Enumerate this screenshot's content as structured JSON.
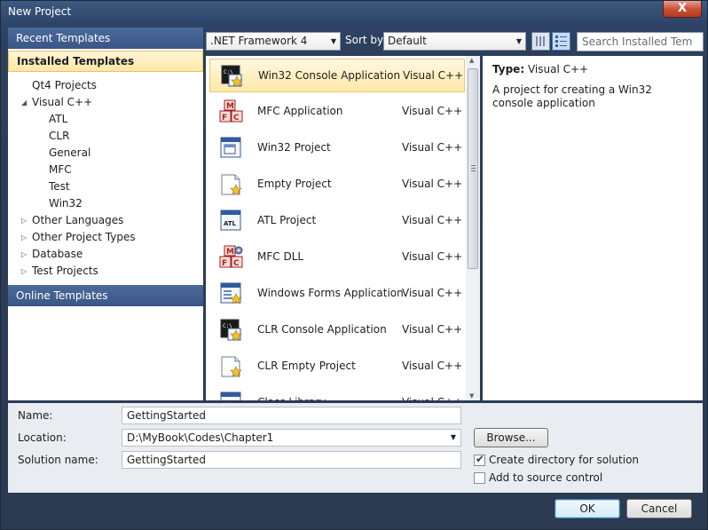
{
  "window": {
    "title": "New Project",
    "close_glyph": "X"
  },
  "left": {
    "recent": "Recent Templates",
    "installed": "Installed Templates",
    "online": "Online Templates",
    "tree": [
      {
        "label": "Qt4 Projects",
        "level": 0,
        "arrow": ""
      },
      {
        "label": "Visual C++",
        "level": 0,
        "arrow": "◢"
      },
      {
        "label": "ATL",
        "level": 1,
        "arrow": ""
      },
      {
        "label": "CLR",
        "level": 1,
        "arrow": ""
      },
      {
        "label": "General",
        "level": 1,
        "arrow": ""
      },
      {
        "label": "MFC",
        "level": 1,
        "arrow": ""
      },
      {
        "label": "Test",
        "level": 1,
        "arrow": ""
      },
      {
        "label": "Win32",
        "level": 1,
        "arrow": ""
      },
      {
        "label": "Other Languages",
        "level": 0,
        "arrow": "▷"
      },
      {
        "label": "Other Project Types",
        "level": 0,
        "arrow": "▷"
      },
      {
        "label": "Database",
        "level": 0,
        "arrow": "▷"
      },
      {
        "label": "Test Projects",
        "level": 0,
        "arrow": "▷"
      }
    ]
  },
  "toolbar": {
    "framework": ".NET Framework 4",
    "sort_label": "Sort by:",
    "sort_value": "Default",
    "search_placeholder": "Search Installed Tem"
  },
  "templates": [
    {
      "name": "Win32 Console Application",
      "lang": "Visual C++",
      "icon": "console-app-icon",
      "selected": true
    },
    {
      "name": "MFC Application",
      "lang": "Visual C++",
      "icon": "mfc-icon"
    },
    {
      "name": "Win32 Project",
      "lang": "Visual C++",
      "icon": "window-app-icon"
    },
    {
      "name": "Empty Project",
      "lang": "Visual C++",
      "icon": "empty-project-icon"
    },
    {
      "name": "ATL Project",
      "lang": "Visual C++",
      "icon": "atl-icon"
    },
    {
      "name": "MFC DLL",
      "lang": "Visual C++",
      "icon": "mfc-dll-icon"
    },
    {
      "name": "Windows Forms Application",
      "lang": "Visual C++",
      "icon": "forms-app-icon"
    },
    {
      "name": "CLR Console Application",
      "lang": "Visual C++",
      "icon": "console-app-icon"
    },
    {
      "name": "CLR Empty Project",
      "lang": "Visual C++",
      "icon": "empty-project-icon"
    },
    {
      "name": "Class Library",
      "lang": "Visual C++",
      "icon": "class-library-icon"
    }
  ],
  "info": {
    "type_key": "Type:",
    "type_value": "Visual C++",
    "description": "A project for creating a Win32 console application"
  },
  "form": {
    "name_label": "Name:",
    "name_value": "GettingStarted",
    "location_label": "Location:",
    "location_value": "D:\\MyBook\\Codes\\Chapter1",
    "solution_label": "Solution name:",
    "solution_value": "GettingStarted",
    "browse_label": "Browse...",
    "create_dir_label": "Create directory for solution",
    "create_dir_checked": true,
    "source_control_label": "Add to source control",
    "source_control_checked": false
  },
  "buttons": {
    "ok": "OK",
    "cancel": "Cancel"
  }
}
